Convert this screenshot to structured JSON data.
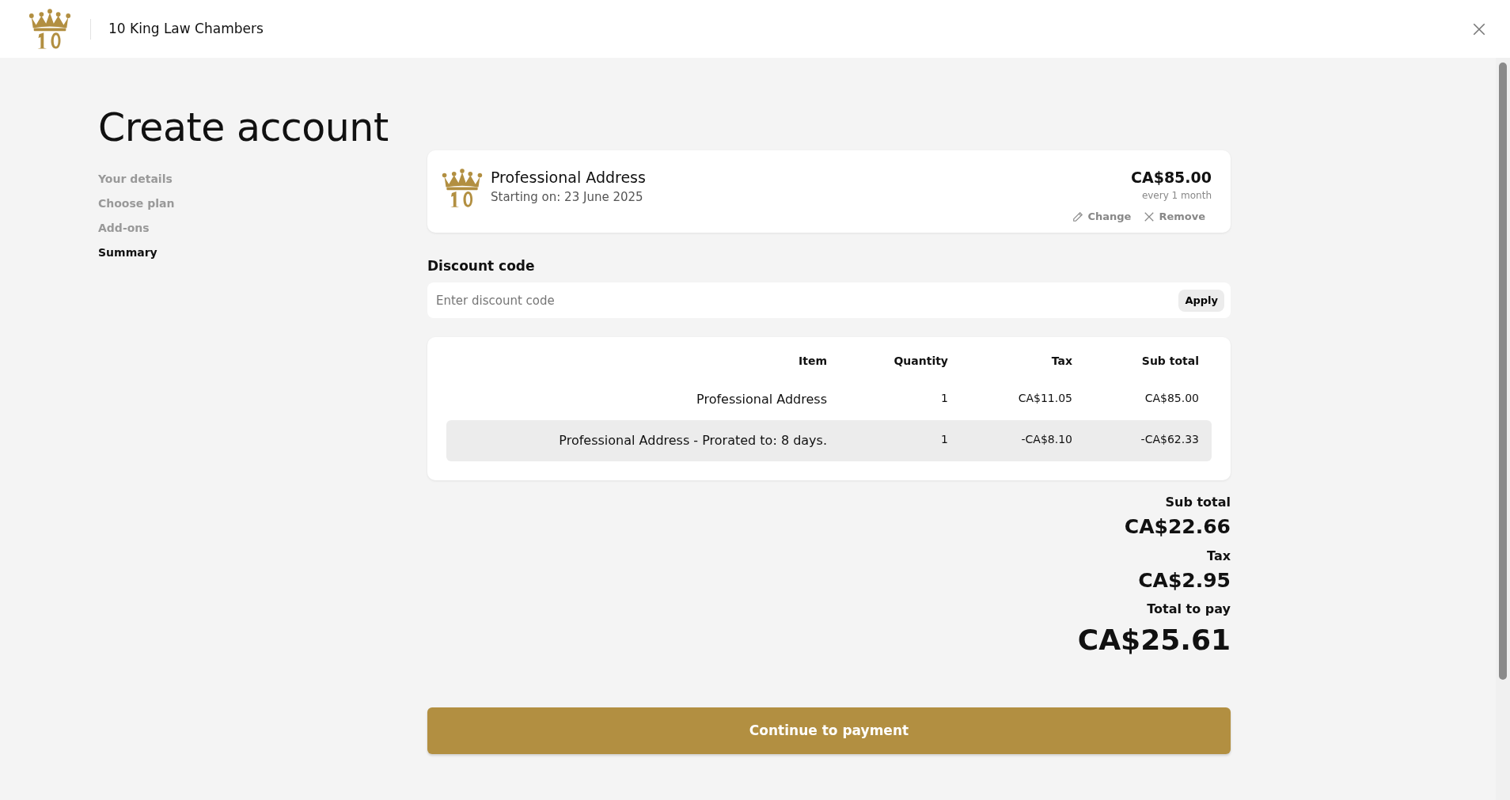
{
  "header": {
    "brand": "10 King Law Chambers"
  },
  "page_title": "Create account",
  "steps": [
    {
      "label": "Your details",
      "selected": false
    },
    {
      "label": "Choose plan",
      "selected": false
    },
    {
      "label": "Add-ons",
      "selected": false
    },
    {
      "label": "Summary",
      "selected": true
    }
  ],
  "product": {
    "name": "Professional Address",
    "start": "Starting on: 23 June 2025",
    "price": "CA$85.00",
    "period": "every 1 month",
    "actions": [
      {
        "kind": "edit",
        "label": "Change"
      },
      {
        "kind": "remove",
        "label": "Remove"
      }
    ]
  },
  "discount": {
    "label": "Discount code",
    "placeholder": "Enter discount code",
    "button": "Apply"
  },
  "table": {
    "columns": [
      "Item",
      "Quantity",
      "Tax",
      "Sub total"
    ],
    "rows": [
      {
        "cells": [
          "Professional Address",
          "1",
          "CA$11.05",
          "CA$85.00"
        ],
        "highlighted": false
      },
      {
        "cells": [
          "Professional Address - Prorated to: 8 days.",
          "1",
          "-CA$8.10",
          "-CA$62.33"
        ],
        "highlighted": true
      }
    ]
  },
  "totals": [
    {
      "label": "Sub total",
      "value": "CA$22.66",
      "kind": "normal"
    },
    {
      "label": "Tax",
      "value": "CA$2.95",
      "kind": "normal"
    },
    {
      "label": "Total to pay",
      "value": "CA$25.61",
      "kind": "grand"
    }
  ],
  "submit": "Continue to payment"
}
